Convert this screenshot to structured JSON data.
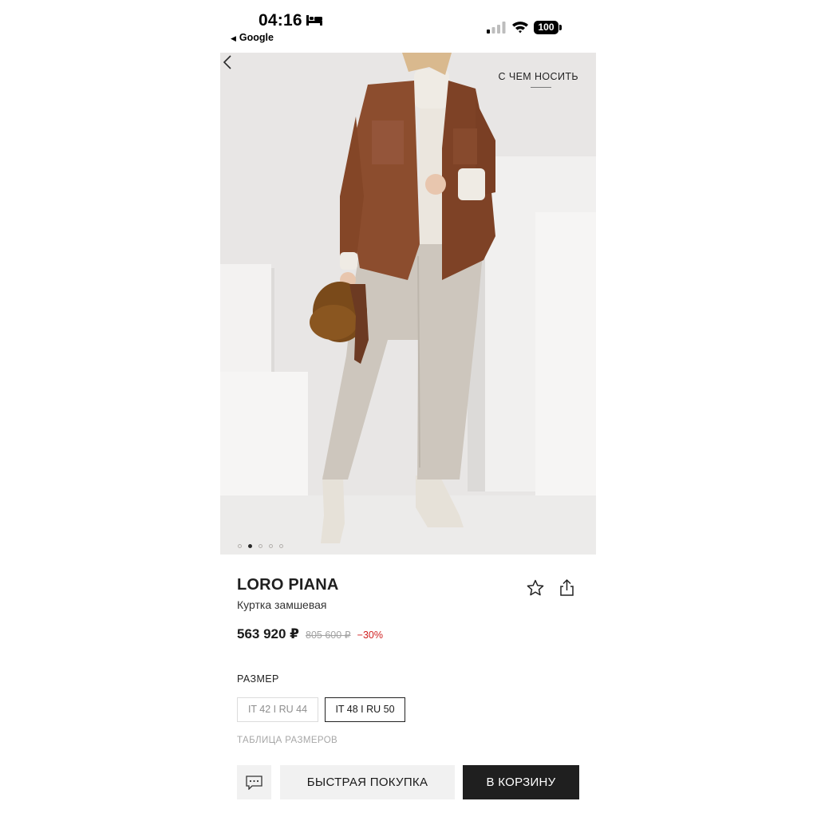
{
  "status_bar": {
    "time": "04:16",
    "back_app": "Google",
    "battery": "100",
    "icons": [
      "bed-icon",
      "signal-icon",
      "wifi-icon",
      "battery-icon"
    ]
  },
  "hero": {
    "wear_with_label": "С ЧЕМ НОСИТЬ",
    "dots_count": 5,
    "active_dot": 1
  },
  "product": {
    "brand": "LORO PIANA",
    "name": "Куртка замшевая",
    "price": "563 920 ₽",
    "old_price": "805 600 ₽",
    "discount": "−30%"
  },
  "sizes": {
    "title": "РАЗМЕР",
    "options": [
      {
        "label": "IT 42 I RU 44",
        "selected": false
      },
      {
        "label": "IT 48 I RU 50",
        "selected": true
      }
    ],
    "table_link": "ТАБЛИЦА РАЗМЕРОВ"
  },
  "actions": {
    "quick_buy": "БЫСТРАЯ ПОКУПКА",
    "add_to_cart": "В КОРЗИНУ"
  },
  "colors": {
    "accent_dark": "#1f1f1f",
    "discount_red": "#d02020",
    "button_grey": "#f1f1f1"
  }
}
